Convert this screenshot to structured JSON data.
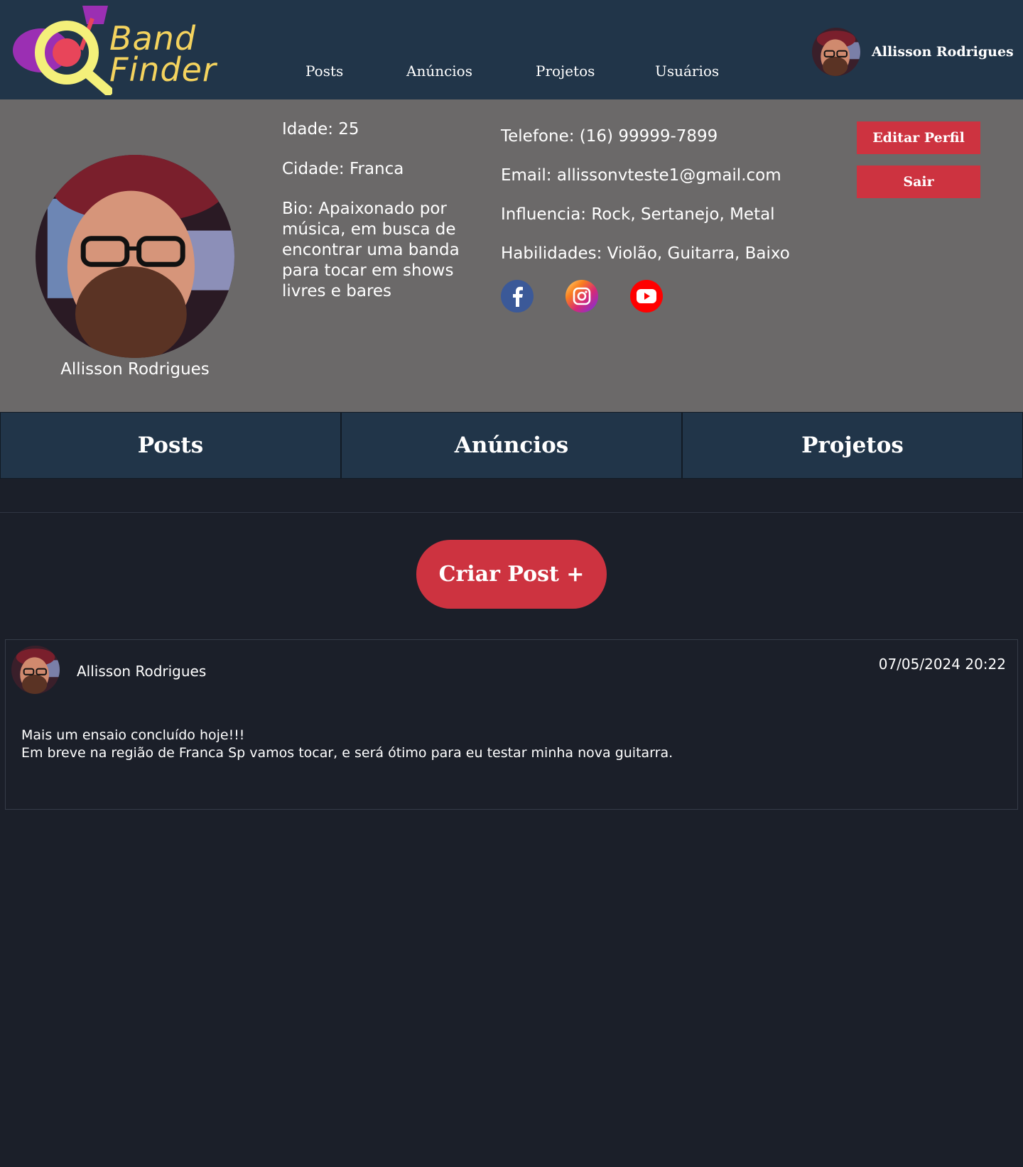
{
  "header": {
    "logo_line1": "Band",
    "logo_line2": "Finder",
    "nav": [
      "Posts",
      "Anúncios",
      "Projetos",
      "Usuários"
    ],
    "user_name": "Allisson Rodrigues"
  },
  "profile": {
    "name": "Allisson Rodrigues",
    "age": "Idade: 25",
    "city": "Cidade: Franca",
    "bio": "Bio: Apaixonado por música, em busca de encontrar uma banda para tocar em shows livres e bares",
    "phone": "Telefone: (16) 99999-7899",
    "email": "Email: allissonvteste1@gmail.com",
    "influences": "Influencia: Rock, Sertanejo, Metal",
    "skills": "Habilidades: Violão, Guitarra, Baixo",
    "socials": [
      "facebook-icon",
      "instagram-icon",
      "youtube-icon"
    ],
    "edit_label": "Editar Perfil",
    "logout_label": "Sair"
  },
  "tabs": [
    "Posts",
    "Anúncios",
    "Projetos"
  ],
  "create_post_label": "Criar Post +",
  "post": {
    "author": "Allisson Rodrigues",
    "date": "07/05/2024 20:22",
    "body": "Mais um ensaio concluído hoje!!!\nEm breve na região de Franca Sp vamos tocar, e será ótimo para eu testar minha nova guitarra."
  },
  "colors": {
    "header_bg": "#213549",
    "profile_bg": "#6b6969",
    "page_bg": "#1b1f29",
    "accent_red": "#cd3340",
    "logo_yellow": "#f4d35e"
  }
}
